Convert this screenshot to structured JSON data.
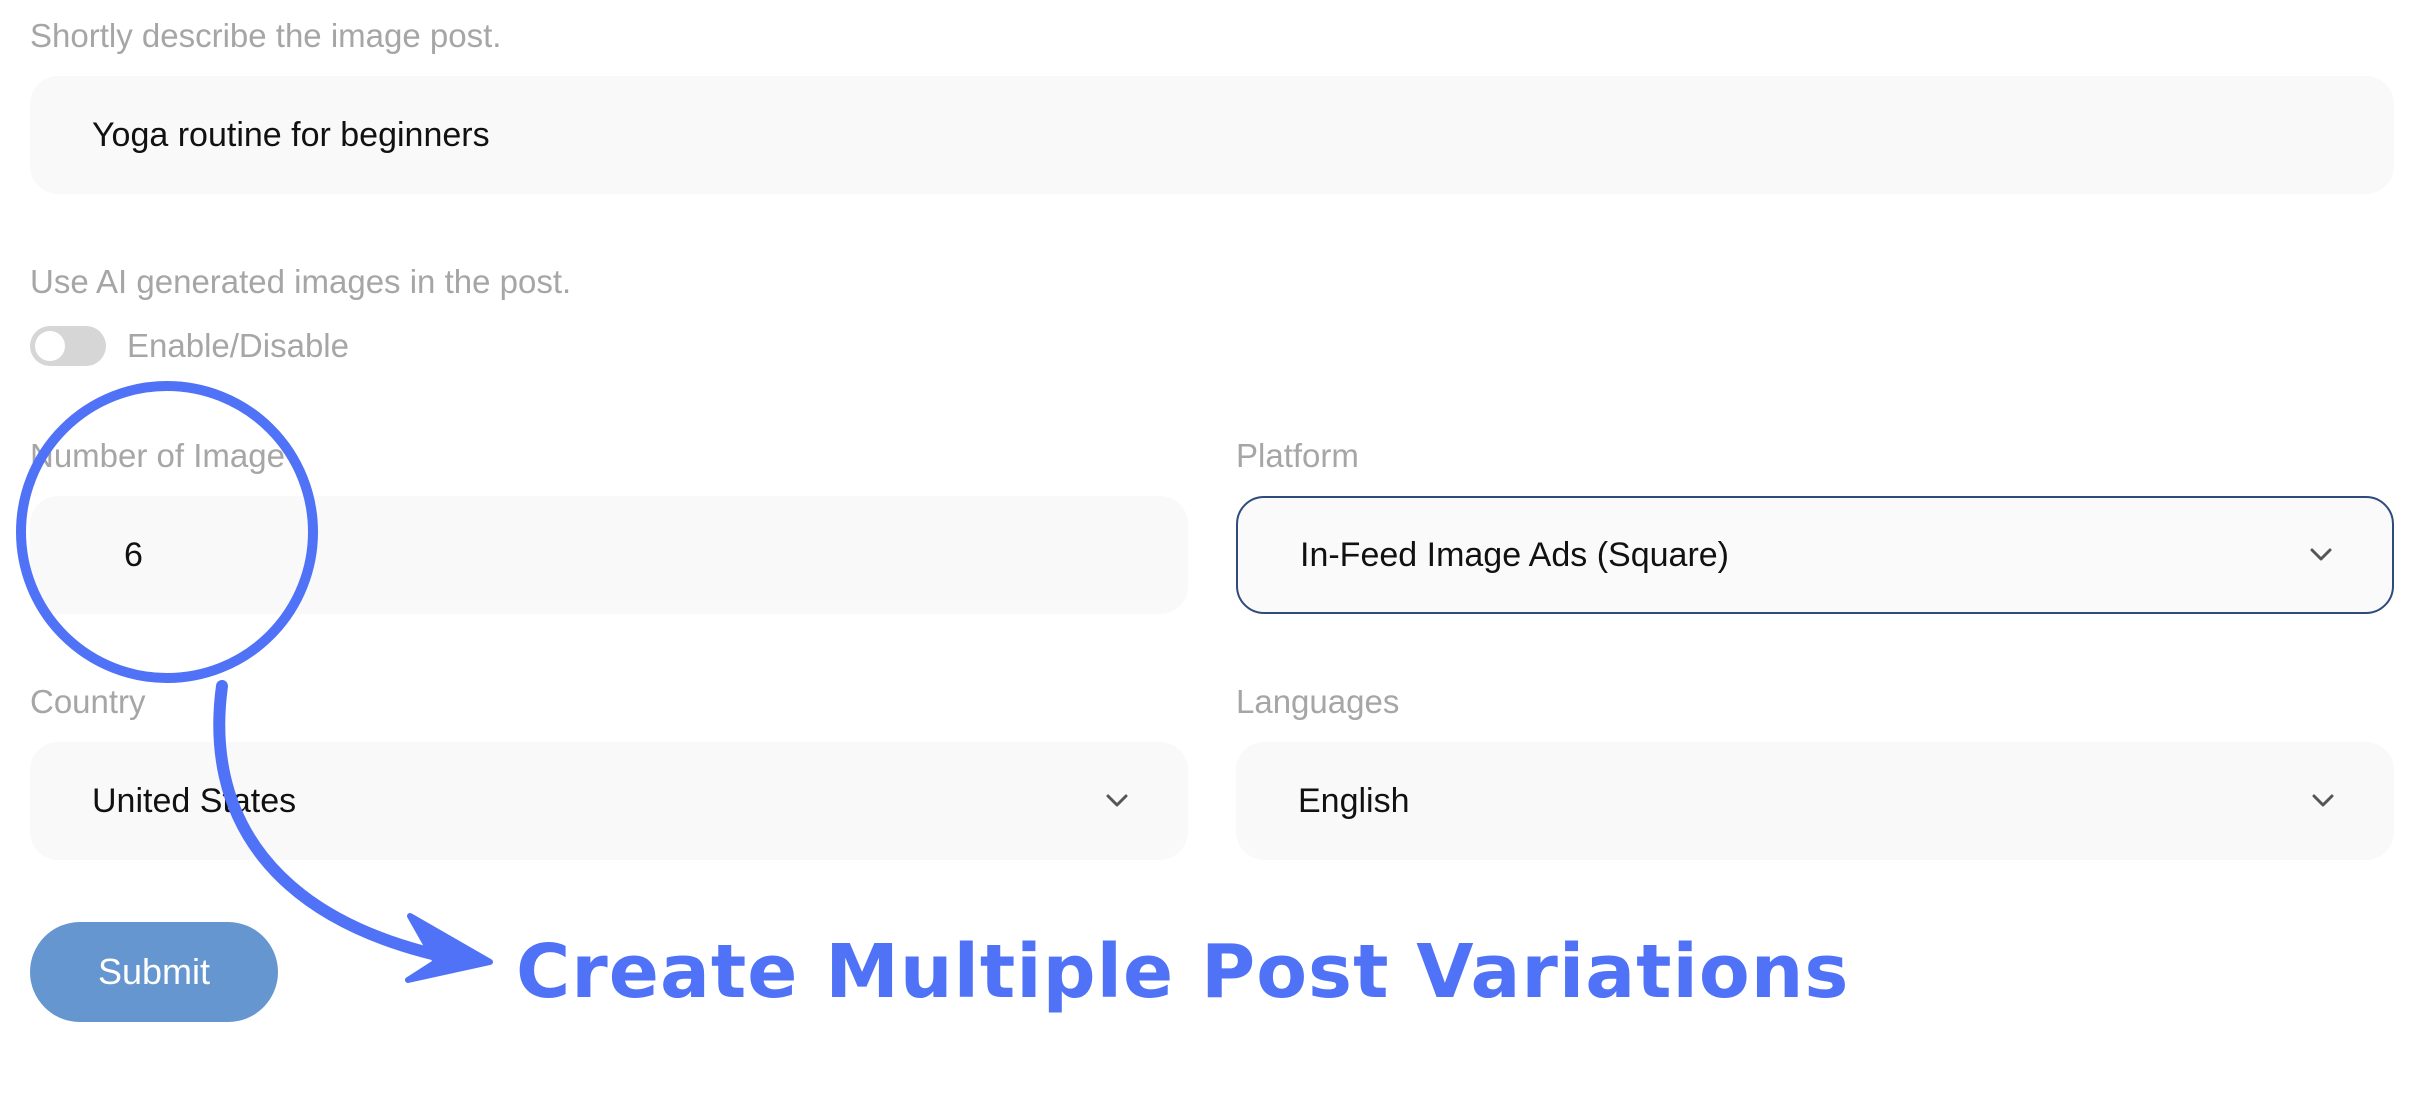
{
  "description": {
    "label": "Shortly describe the image post.",
    "value": "Yoga routine for beginners"
  },
  "ai_images": {
    "label": "Use AI generated images in the post.",
    "toggle_label": "Enable/Disable",
    "enabled": false
  },
  "number_of_image": {
    "label": "Number of Image",
    "value": "6"
  },
  "platform": {
    "label": "Platform",
    "selected": "In-Feed Image Ads (Square)"
  },
  "country": {
    "label": "Country",
    "selected": "United States"
  },
  "languages": {
    "label": "Languages",
    "selected": "English"
  },
  "submit_label": "Submit",
  "annotation": {
    "text": "Create Multiple Post Variations"
  },
  "colors": {
    "submit": "#6596cf",
    "annotation": "#4f72f7",
    "focus_border": "#2f4a7c",
    "label_text": "#a6a6a6",
    "field_bg": "#f9f9f9"
  },
  "icons": {
    "dropdown": "chevron-down-icon",
    "annotation_circle": "highlight-circle",
    "annotation_arrow": "curved-arrow"
  }
}
